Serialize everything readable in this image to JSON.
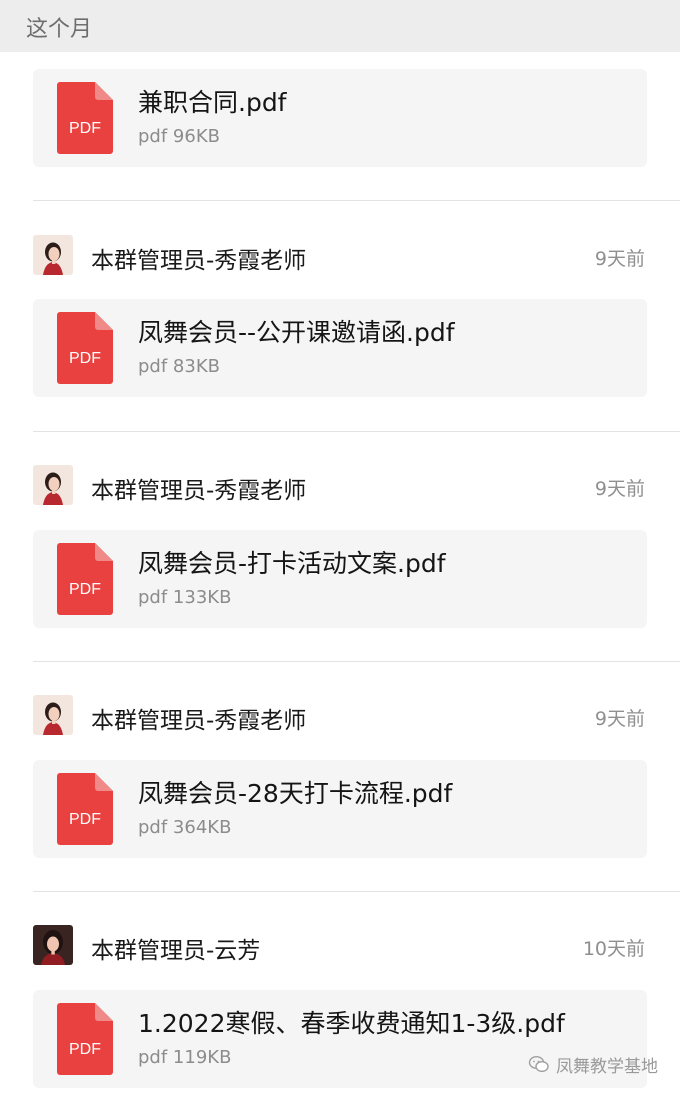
{
  "section": {
    "title": "这个月"
  },
  "items": [
    {
      "sender": null,
      "file": {
        "name": "兼职合同.pdf",
        "meta": "pdf 96KB",
        "icon": "pdf-icon"
      }
    },
    {
      "sender": {
        "name": "本群管理员-秀霞老师",
        "time": "9天前",
        "avatar": "avatar-portrait"
      },
      "file": {
        "name": "凤舞会员--公开课邀请函.pdf",
        "meta": "pdf 83KB",
        "icon": "pdf-icon"
      }
    },
    {
      "sender": {
        "name": "本群管理员-秀霞老师",
        "time": "9天前",
        "avatar": "avatar-portrait"
      },
      "file": {
        "name": "凤舞会员-打卡活动文案.pdf",
        "meta": "pdf 133KB",
        "icon": "pdf-icon"
      }
    },
    {
      "sender": {
        "name": "本群管理员-秀霞老师",
        "time": "9天前",
        "avatar": "avatar-portrait"
      },
      "file": {
        "name": "凤舞会员-28天打卡流程.pdf",
        "meta": "pdf 364KB",
        "icon": "pdf-icon"
      }
    },
    {
      "sender": {
        "name": "本群管理员-云芳",
        "time": "10天前",
        "avatar": "avatar-portrait"
      },
      "file": {
        "name": "1.2022寒假、春季收费通知1-3级.pdf",
        "meta": "pdf 119KB",
        "icon": "pdf-icon"
      }
    }
  ],
  "pdf_icon_label": "PDF",
  "watermark": {
    "text": "凤舞教学基地",
    "icon": "wechat-channel-icon"
  },
  "colors": {
    "pdf_red": "#e9413f",
    "pdf_fold": "#f08a89",
    "card_bg": "#f5f5f5",
    "header_bg": "#ededed"
  }
}
